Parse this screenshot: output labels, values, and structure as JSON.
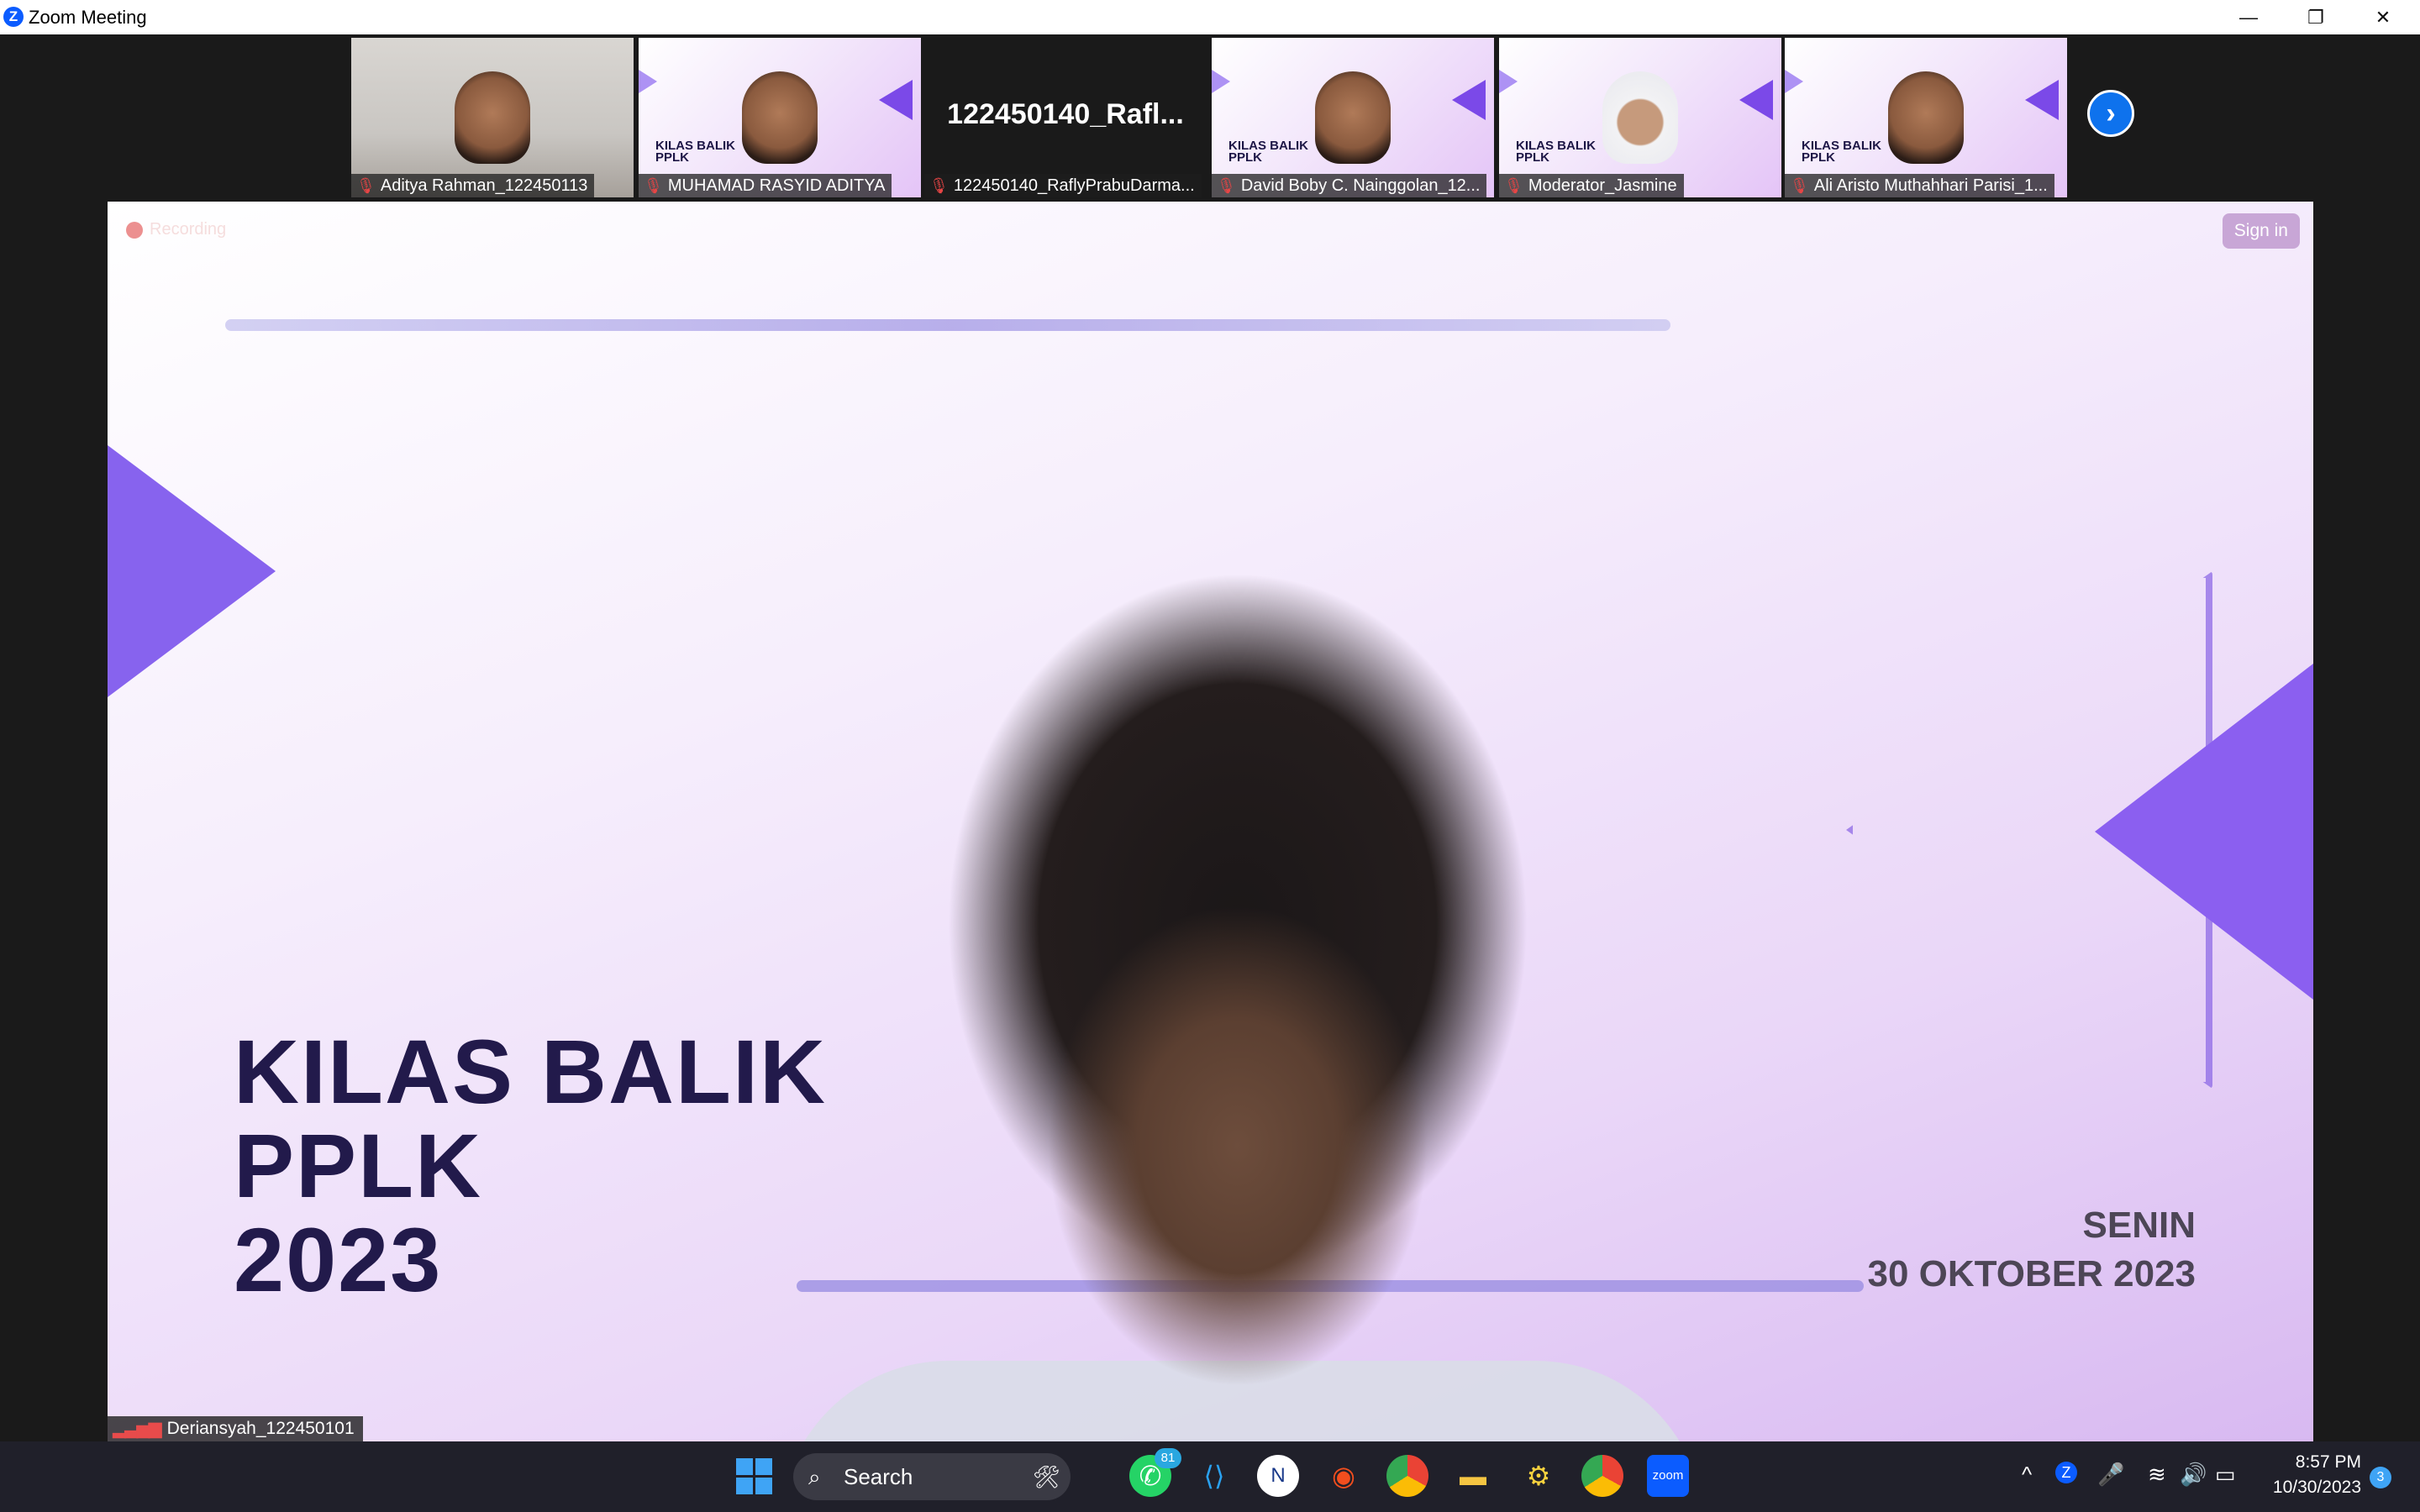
{
  "window": {
    "title": "Zoom Meeting",
    "controls": {
      "minimize": "—",
      "restore": "❐",
      "close": "✕"
    }
  },
  "thumbnails": [
    {
      "name": "Aditya Rahman_122450113",
      "kind": "camera"
    },
    {
      "name": "MUHAMAD RASYID ADITYA",
      "kind": "slide"
    },
    {
      "name": "122450140_RaflyPrabuDarma...",
      "kind": "no-video",
      "display_name": "122450140_Rafl..."
    },
    {
      "name": "David Boby C. Nainggolan_12...",
      "kind": "slide"
    },
    {
      "name": "Moderator_Jasmine",
      "kind": "slide"
    },
    {
      "name": "Ali Aristo Muthahhari Parisi_1...",
      "kind": "slide"
    }
  ],
  "thumbnail_slide_text": "KILAS BALIK\nPPLK",
  "next_page_icon": "chevron-right-icon",
  "main_video": {
    "recording_label": "Recording",
    "sign_in_label": "Sign in",
    "slide_title_line1": "KILAS BALIK",
    "slide_title_line2": "PPLK",
    "slide_title_line3": "2023",
    "slide_day": "SENIN",
    "slide_date": "30 OKTOBER 2023",
    "speaker_name": "Deriansyah_122450101"
  },
  "taskbar": {
    "search_label": "Search",
    "whatsapp_badge": "81",
    "time": "8:57 PM",
    "date": "10/30/2023",
    "notification_count": "3",
    "apps": [
      "start",
      "search",
      "whatsapp",
      "vscode",
      "app",
      "figma",
      "chrome",
      "file-explorer",
      "python",
      "chrome-profile",
      "zoom"
    ]
  },
  "colors": {
    "accent": "#0e72ed",
    "slide_purple": "#8763ee",
    "slide_text": "#221a4b",
    "taskbar_bg": "#20202a"
  }
}
